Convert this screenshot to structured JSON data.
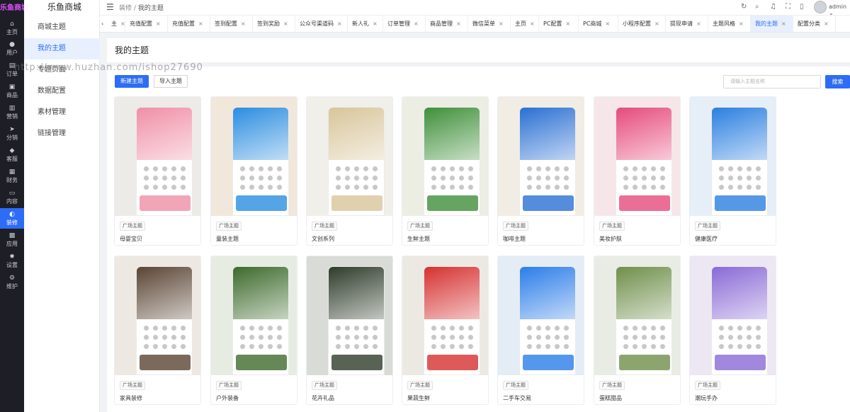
{
  "app": {
    "logo": "乐鱼商城",
    "brand_mark": "乐鱼商城"
  },
  "rail": [
    {
      "label": "主页",
      "icon": "home-icon",
      "glyph": "⌂"
    },
    {
      "label": "用户",
      "icon": "user-icon",
      "glyph": "●"
    },
    {
      "label": "订单",
      "icon": "order-icon",
      "glyph": "▤"
    },
    {
      "label": "商品",
      "icon": "goods-icon",
      "glyph": "▣"
    },
    {
      "label": "营销",
      "icon": "marketing-icon",
      "glyph": "▥"
    },
    {
      "label": "分销",
      "icon": "distribution-icon",
      "glyph": "➤"
    },
    {
      "label": "客服",
      "icon": "service-icon",
      "glyph": "◆"
    },
    {
      "label": "财务",
      "icon": "finance-icon",
      "glyph": "▦"
    },
    {
      "label": "内容",
      "icon": "content-icon",
      "glyph": "▭"
    },
    {
      "label": "装修",
      "icon": "decorate-icon",
      "glyph": "◐",
      "active": true
    },
    {
      "label": "应用",
      "icon": "apps-icon",
      "glyph": "▩"
    },
    {
      "label": "设置",
      "icon": "settings-icon",
      "glyph": "✹"
    },
    {
      "label": "维护",
      "icon": "maintain-icon",
      "glyph": "⚙"
    }
  ],
  "submenu": {
    "title": "乐鱼商城",
    "items": [
      {
        "label": "商城主题"
      },
      {
        "label": "我的主题",
        "active": true
      },
      {
        "label": "专题页面"
      },
      {
        "label": "数据配置"
      },
      {
        "label": "素材管理"
      },
      {
        "label": "链接管理"
      }
    ]
  },
  "header": {
    "breadcrumb": [
      "装修",
      "/",
      "我的主题"
    ],
    "user": "admin"
  },
  "tabs": [
    {
      "label": "主"
    },
    {
      "label": "充值配置"
    },
    {
      "label": "充值配置"
    },
    {
      "label": "签到配置"
    },
    {
      "label": "签到奖励"
    },
    {
      "label": "公众号渠道码"
    },
    {
      "label": "新人礼"
    },
    {
      "label": "订单管理"
    },
    {
      "label": "商品管理"
    },
    {
      "label": "微信菜单"
    },
    {
      "label": "主页"
    },
    {
      "label": "PC配置"
    },
    {
      "label": "PC商城"
    },
    {
      "label": "小程序配置"
    },
    {
      "label": "提现申请"
    },
    {
      "label": "主题风格"
    },
    {
      "label": "我的主题",
      "active": true
    },
    {
      "label": "配置分类"
    }
  ],
  "page": {
    "title": "我的主题",
    "new_button": "新建主题",
    "import_button": "导入主题",
    "search_placeholder": "请输入主题名称",
    "search_button": "搜索",
    "watermark": "http://www.huzhan.com/ishop27690"
  },
  "themes": [
    {
      "tag": "广场主题",
      "name": "母婴宝贝",
      "color": "#f08fa6",
      "bg": "#ecebe8"
    },
    {
      "tag": "广场主题",
      "name": "童装主题",
      "color": "#2b8de0",
      "bg": "#f1e7db"
    },
    {
      "tag": "广场主题",
      "name": "文创系列",
      "color": "#d8c59a",
      "bg": "#f0efe9"
    },
    {
      "tag": "广场主题",
      "name": "生鲜主题",
      "color": "#3f8f3a",
      "bg": "#eceee4"
    },
    {
      "tag": "广场主题",
      "name": "咖啡主题",
      "color": "#2a6fd3",
      "bg": "#f1ede4"
    },
    {
      "tag": "广场主题",
      "name": "美妆护肤",
      "color": "#e64a7c",
      "bg": "#f6e6ea"
    },
    {
      "tag": "广场主题",
      "name": "健康医疗",
      "color": "#2a7fe0",
      "bg": "#e6eef7"
    },
    {
      "tag": "广场主题",
      "name": "家具装修",
      "color": "#5a4433",
      "bg": "#eee8e2"
    },
    {
      "tag": "广场主题",
      "name": "户外装备",
      "color": "#3d6a2c",
      "bg": "#e7ece3"
    },
    {
      "tag": "广场主题",
      "name": "花卉礼品",
      "color": "#2e3b2a",
      "bg": "#d9dbd6"
    },
    {
      "tag": "广场主题",
      "name": "果蔬生鲜",
      "color": "#d63131",
      "bg": "#ece9e2"
    },
    {
      "tag": "广场主题",
      "name": "二手车交易",
      "color": "#2b7de9",
      "bg": "#e4ecf5"
    },
    {
      "tag": "广场主题",
      "name": "蛋糕甜品",
      "color": "#6f8f4b",
      "bg": "#e9ece4"
    },
    {
      "tag": "广场主题",
      "name": "潮玩手办",
      "color": "#8a6ad6",
      "bg": "#ece7f3"
    }
  ]
}
